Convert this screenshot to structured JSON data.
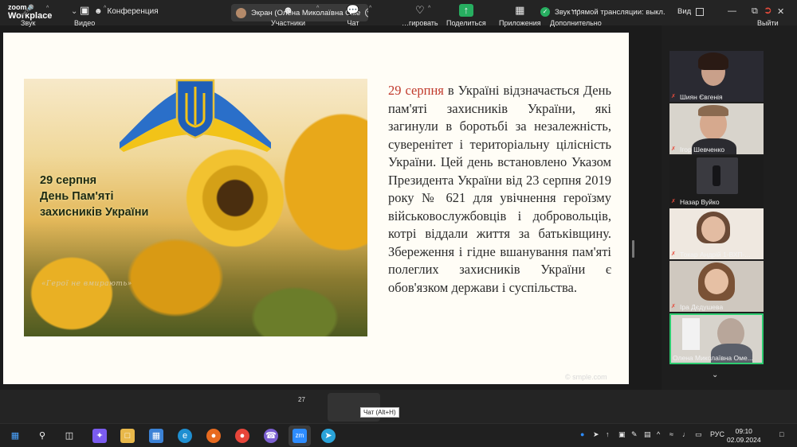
{
  "topbar": {
    "logo_line1": "zoom",
    "logo_line2": "Workplace",
    "meeting_label": "Конференция",
    "share_label": "Экран (Олена Миколаївна Оме",
    "live_audio": "Звук прямой трансляции: выкл.",
    "view_label": "Вид"
  },
  "slide": {
    "photo_lines": [
      "29 серпня",
      "День Пам'яті",
      "захисників України"
    ],
    "motto": "«Герої не вмирають»",
    "body_red": "29 серпня",
    "body_rest": " в Україні відзначається День пам'яті захисників України, які загинули в боротьбі за незалежність, суверенітет і територіальну цілісність України. Цей день встановлено Указом Президента України від 23 серпня 2019 року № 621 для увічнення героїзму військовослужбовців і добровольців, котрі віддали життя за батьківщину. Збереження і гідне вшанування пам'яті полеглих захисників України є обов'язком держави і суспільства.",
    "watermark": "© smple.com"
  },
  "participants": [
    {
      "name": "Шиян Євгенія",
      "muted": true
    },
    {
      "name": "Ігор Шевченко",
      "muted": true
    },
    {
      "name": "Назар Вуйко",
      "muted": true
    },
    {
      "name": "Токар Андрій 1-ВХП-...",
      "muted": true
    },
    {
      "name": "Іра Дєдушева",
      "muted": true
    },
    {
      "name": "Олена Миколаївна Оме...",
      "muted": false
    }
  ],
  "toolbar": {
    "audio": "Звук",
    "video": "Видео",
    "participants": "Участники",
    "participants_count": "27",
    "chat": "Чат",
    "react": "…гировать",
    "share": "Поделиться",
    "apps": "Приложения",
    "more": "Дополнительно",
    "leave": "Выйти",
    "tooltip": "Чат (Alt+H)"
  },
  "taskbar": {
    "lang": "РУС",
    "time": "09:10",
    "date": "02.09.2024"
  },
  "colors": {
    "accent_green": "#27ae60",
    "muted_red": "#e74c3c",
    "slide_red": "#c0392b"
  }
}
